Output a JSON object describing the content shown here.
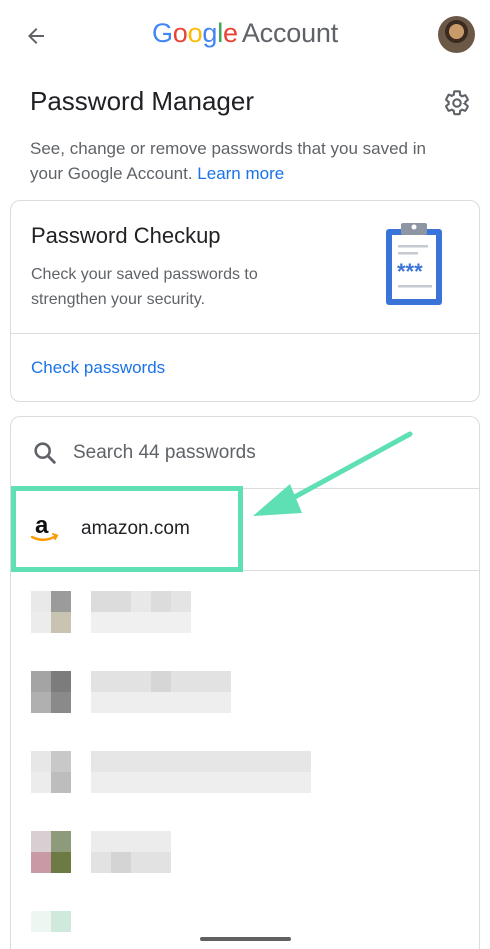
{
  "header": {
    "back_label": "Back",
    "brand_google": [
      "G",
      "o",
      "o",
      "g",
      "l",
      "e"
    ],
    "brand_account": "Account",
    "avatar_alt": "avatar"
  },
  "main": {
    "title": "Password Manager",
    "description": "See, change or remove passwords that you saved in your Google Account.",
    "learn_more": "Learn more"
  },
  "checkup": {
    "title": "Password Checkup",
    "text": "Check your saved passwords to strengthen your security.",
    "action": "Check passwords",
    "clipboard_text": "***"
  },
  "passwords": {
    "search_placeholder": "Search 44 passwords",
    "highlighted_site": "amazon.com"
  },
  "colors": {
    "accent": "#1a73e8",
    "highlight": "#5fe0b4",
    "clipboard_blue": "#3b74d8"
  },
  "icons": [
    "back-arrow-icon",
    "gear-icon",
    "search-icon",
    "amazon-logo-icon",
    "clipboard-icon"
  ]
}
